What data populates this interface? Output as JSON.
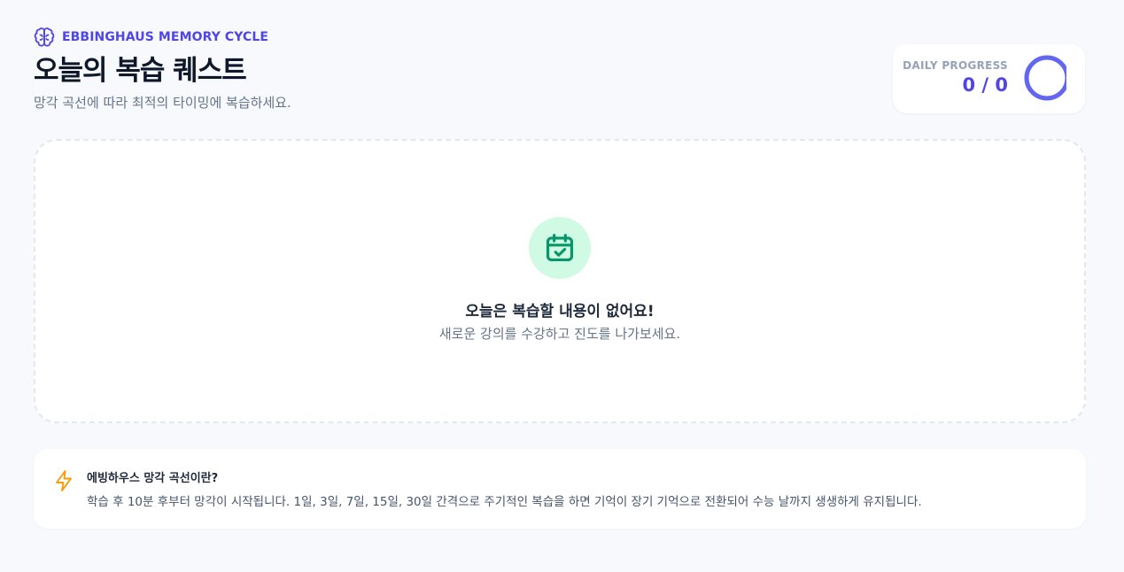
{
  "header": {
    "eyebrow": "EBBINGHAUS MEMORY CYCLE",
    "title": "오늘의 복습 퀘스트",
    "subtitle": "망각 곡선에 따라 최적의 타이밍에 복습하세요."
  },
  "progress": {
    "label": "DAILY PROGRESS",
    "count": "0 / 0",
    "completed": 0,
    "total": 0
  },
  "empty_state": {
    "title": "오늘은 복습할 내용이 없어요!",
    "subtitle": "새로운 강의를 수강하고 진도를 나가보세요."
  },
  "info": {
    "title": "에빙하우스 망각 곡선이란?",
    "body": "학습 후 10분 후부터 망각이 시작됩니다. 1일, 3일, 7일, 15일, 30일 간격으로 주기적인 복습을 하면 기억이 장기 기억으로 전환되어 수능 날까지 생생하게 유지됩니다."
  },
  "icons": {
    "eyebrow": "brain-icon",
    "empty": "calendar-check-icon",
    "info": "lightning-icon"
  },
  "colors": {
    "accent": "#4f46e5",
    "ring": "#6366f1",
    "success_bg": "#d1fae5",
    "success": "#059669",
    "warning": "#f59e0b"
  }
}
